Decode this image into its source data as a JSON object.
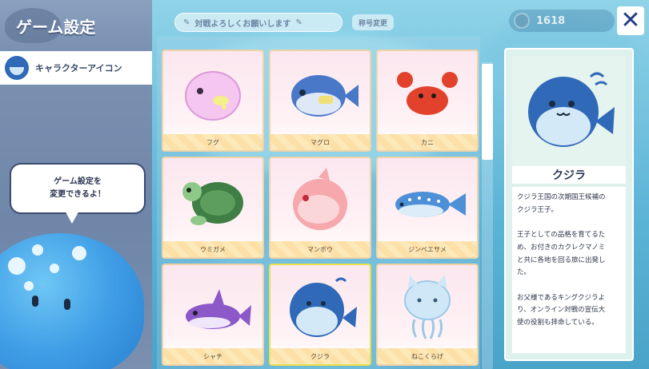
{
  "sidebar": {
    "title": "ゲーム設定",
    "items": [
      {
        "label": "キャラクターアイコン",
        "icon": "whale-icon"
      }
    ],
    "bubble_line1": "ゲーム設定を",
    "bubble_line2": "変更できるよ！"
  },
  "topbar": {
    "player_name": "対戦よろしくお願いします",
    "rename_label": "称号変更",
    "coins": "1618",
    "close_label": "✕"
  },
  "grid": {
    "items": [
      {
        "label": "フグ"
      },
      {
        "label": "マグロ"
      },
      {
        "label": "カニ"
      },
      {
        "label": "ウミガメ"
      },
      {
        "label": "マンボウ"
      },
      {
        "label": "ジンベエサメ"
      },
      {
        "label": "シャチ"
      },
      {
        "label": "クジラ",
        "selected": true
      },
      {
        "label": "ねこくらげ"
      }
    ]
  },
  "detail": {
    "name": "クジラ",
    "description": "クジラ王国の次期国王候補の\nクジラ王子。\n\n王子としての品格を育てるた\nめ、お付きのカクレクマノミ\nと共に各地を回る旅に出発し\nた。\n\nお父様であるキングクジラよ\nり、オンライン対戦の宣伝大\n使の役割も拝命している。"
  },
  "colors": {
    "accent": "#253d86",
    "card_border": "#f0d2a8",
    "selected_border": "#e9e04a",
    "label_stripe": "#fde8b8"
  }
}
